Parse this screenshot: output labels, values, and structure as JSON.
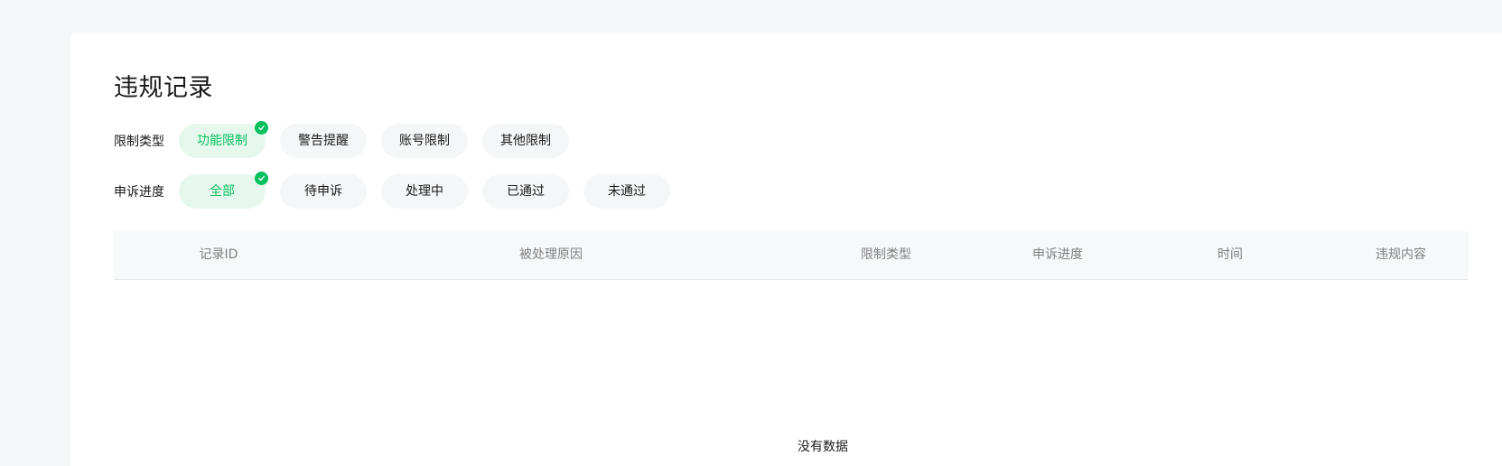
{
  "page": {
    "title": "违规记录"
  },
  "filters": {
    "restriction_type": {
      "label": "限制类型",
      "options": [
        {
          "label": "功能限制",
          "selected": true
        },
        {
          "label": "警告提醒",
          "selected": false
        },
        {
          "label": "账号限制",
          "selected": false
        },
        {
          "label": "其他限制",
          "selected": false
        }
      ]
    },
    "appeal_progress": {
      "label": "申诉进度",
      "options": [
        {
          "label": "全部",
          "selected": true
        },
        {
          "label": "待申诉",
          "selected": false
        },
        {
          "label": "处理中",
          "selected": false
        },
        {
          "label": "已通过",
          "selected": false
        },
        {
          "label": "未通过",
          "selected": false
        }
      ]
    }
  },
  "table": {
    "columns": [
      "记录ID",
      "被处理原因",
      "限制类型",
      "申诉进度",
      "时间",
      "违规内容"
    ],
    "rows": [],
    "empty_text": "没有数据"
  },
  "colors": {
    "accent": "#07c160",
    "selected_chip_bg": "#e6f8ed",
    "chip_bg": "#f5f6f7",
    "page_bg": "#f5f6f7",
    "header_bg": "#f7f8fa"
  },
  "icons": {
    "selected_badge": "check-circle-icon"
  }
}
